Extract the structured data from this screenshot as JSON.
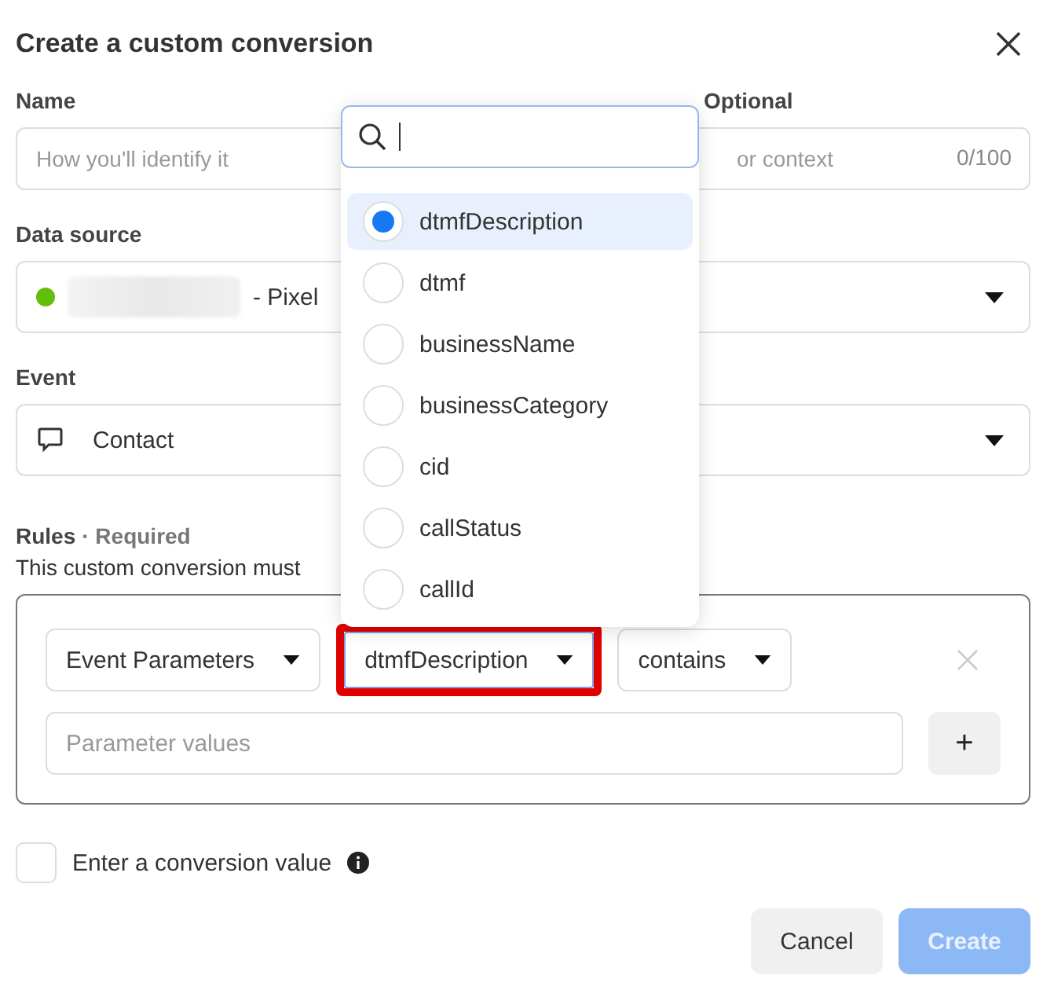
{
  "dialog": {
    "title": "Create a custom conversion"
  },
  "name_field": {
    "label": "Name",
    "placeholder": "How you'll identify it"
  },
  "description_field": {
    "label": "Optional",
    "placeholder": "or context",
    "counter": "0/100"
  },
  "data_source": {
    "label": "Data source",
    "value": "- Pixel"
  },
  "event": {
    "label": "Event",
    "value": "Contact"
  },
  "rules": {
    "label": "Rules",
    "required": "· Required",
    "description": "This custom conversion must",
    "conditions": [
      {
        "kind": "select",
        "value": "Event Parameters",
        "highlighted": false
      },
      {
        "kind": "select",
        "value": "dtmfDescription",
        "highlighted": true
      },
      {
        "kind": "select",
        "value": "contains",
        "highlighted": false
      }
    ],
    "values_placeholder": "Parameter values",
    "add_label": "+"
  },
  "conversion_value": {
    "label": "Enter a conversion value",
    "checked": false
  },
  "buttons": [
    {
      "label": "Cancel",
      "kind": "secondary",
      "disabled": false
    },
    {
      "label": "Create",
      "kind": "primary",
      "disabled": true
    }
  ],
  "dropdown": {
    "options": [
      {
        "label": "dtmfDescription",
        "selected": true
      },
      {
        "label": "dtmf",
        "selected": false
      },
      {
        "label": "businessName",
        "selected": false
      },
      {
        "label": "businessCategory",
        "selected": false
      },
      {
        "label": "cid",
        "selected": false
      },
      {
        "label": "callStatus",
        "selected": false
      },
      {
        "label": "callId",
        "selected": false
      }
    ]
  }
}
